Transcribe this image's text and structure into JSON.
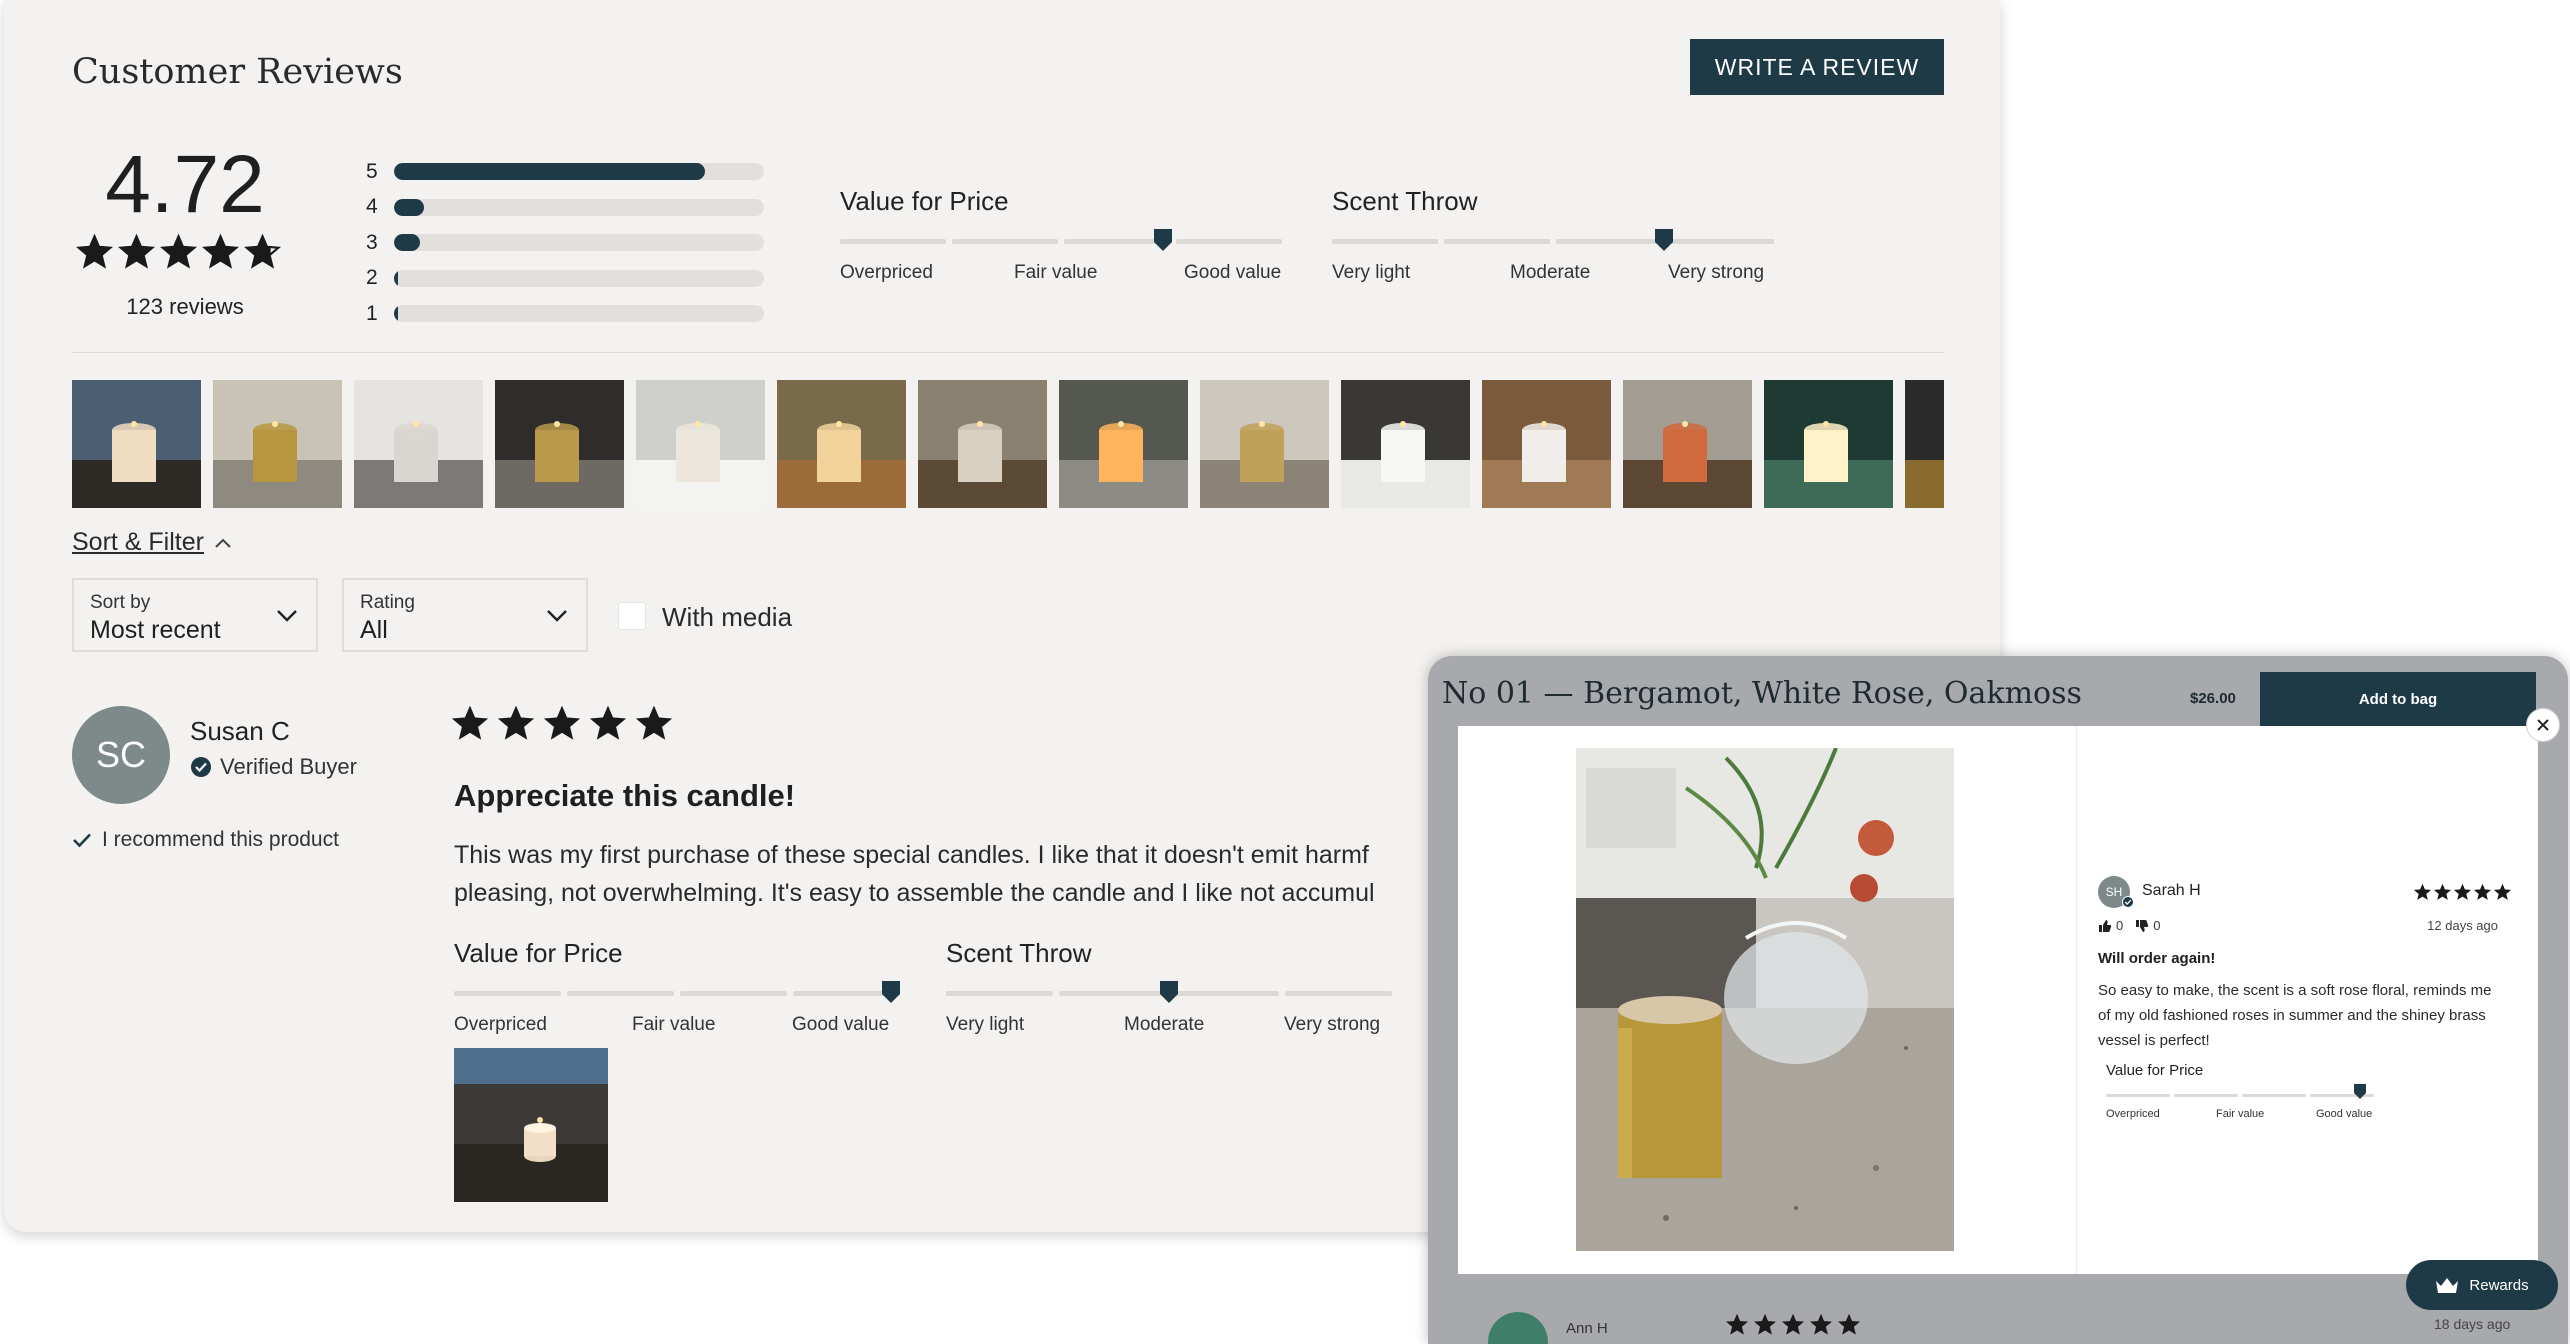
{
  "reviews": {
    "title": "Customer Reviews",
    "write_review_label": "WRITE A REVIEW",
    "average": "4.72",
    "avg_stars": 4.72,
    "count_label": "123 reviews",
    "histogram": [
      {
        "label": "5",
        "fraction": 0.84
      },
      {
        "label": "4",
        "fraction": 0.08
      },
      {
        "label": "3",
        "fraction": 0.07
      },
      {
        "label": "2",
        "fraction": 0.01
      },
      {
        "label": "1",
        "fraction": 0.01
      }
    ],
    "summary_sliders": {
      "value_for_price": {
        "title": "Value for Price",
        "labels": [
          "Overpriced",
          "Fair value",
          "Good value"
        ],
        "position": 0.73
      },
      "scent_throw": {
        "title": "Scent Throw",
        "labels": [
          "Very light",
          "Moderate",
          "Very strong"
        ],
        "position": 0.75
      }
    },
    "photo_strip": [
      "candle-photo-1",
      "candle-photo-2",
      "candle-photo-3",
      "candle-photo-4",
      "candle-photo-5",
      "candle-photo-6",
      "candle-photo-7",
      "candle-photo-8",
      "candle-photo-9",
      "candle-photo-10",
      "candle-photo-11",
      "candle-photo-12",
      "candle-photo-13",
      "candle-photo-14"
    ],
    "sort_filter_label": "Sort & Filter",
    "sort": {
      "label": "Sort by",
      "value": "Most recent"
    },
    "rating_filter": {
      "label": "Rating",
      "value": "All"
    },
    "with_media_label": "With media",
    "review": {
      "initials": "SC",
      "author": "Susan C",
      "verified_label": "Verified Buyer",
      "recommend_label": "I recommend this product",
      "stars": 5,
      "title": "Appreciate this candle!",
      "body_line1": "This was my first purchase of these special candles. I like that it doesn't emit harmf",
      "body_line2": "pleasing, not overwhelming. It's easy to assemble the candle and I like not accumul",
      "value_for_price": {
        "title": "Value for Price",
        "labels": [
          "Overpriced",
          "Fair value",
          "Good value"
        ],
        "position": 0.98
      },
      "scent_throw": {
        "title": "Scent Throw",
        "labels": [
          "Very light",
          "Moderate",
          "Very strong"
        ],
        "position": 0.5
      }
    }
  },
  "modal": {
    "product_title": "No 01 — Bergamot, White Rose, Oakmoss",
    "price": "$26.00",
    "add_to_bag_label": "Add to bag",
    "review": {
      "initials": "SH",
      "author": "Sarah H",
      "stars": 5,
      "helpful_yes": "0",
      "helpful_no": "0",
      "date": "12 days ago",
      "title": "Will order again!",
      "body": "So easy to make, the scent is a soft rose floral, reminds me of my old fashioned roses in summer and the shiney brass vessel is perfect!",
      "value_for_price": {
        "title": "Value for Price",
        "labels": [
          "Overpriced",
          "Fair value",
          "Good value"
        ],
        "position": 0.98
      }
    },
    "next_review": {
      "author": "Ann H",
      "stars": 5,
      "date": "18 days ago"
    },
    "rewards_label": "Rewards"
  },
  "colors": {
    "accent": "#1f3a47",
    "panel_bg": "#f4f2f0",
    "avatar": "#7d8a89"
  }
}
